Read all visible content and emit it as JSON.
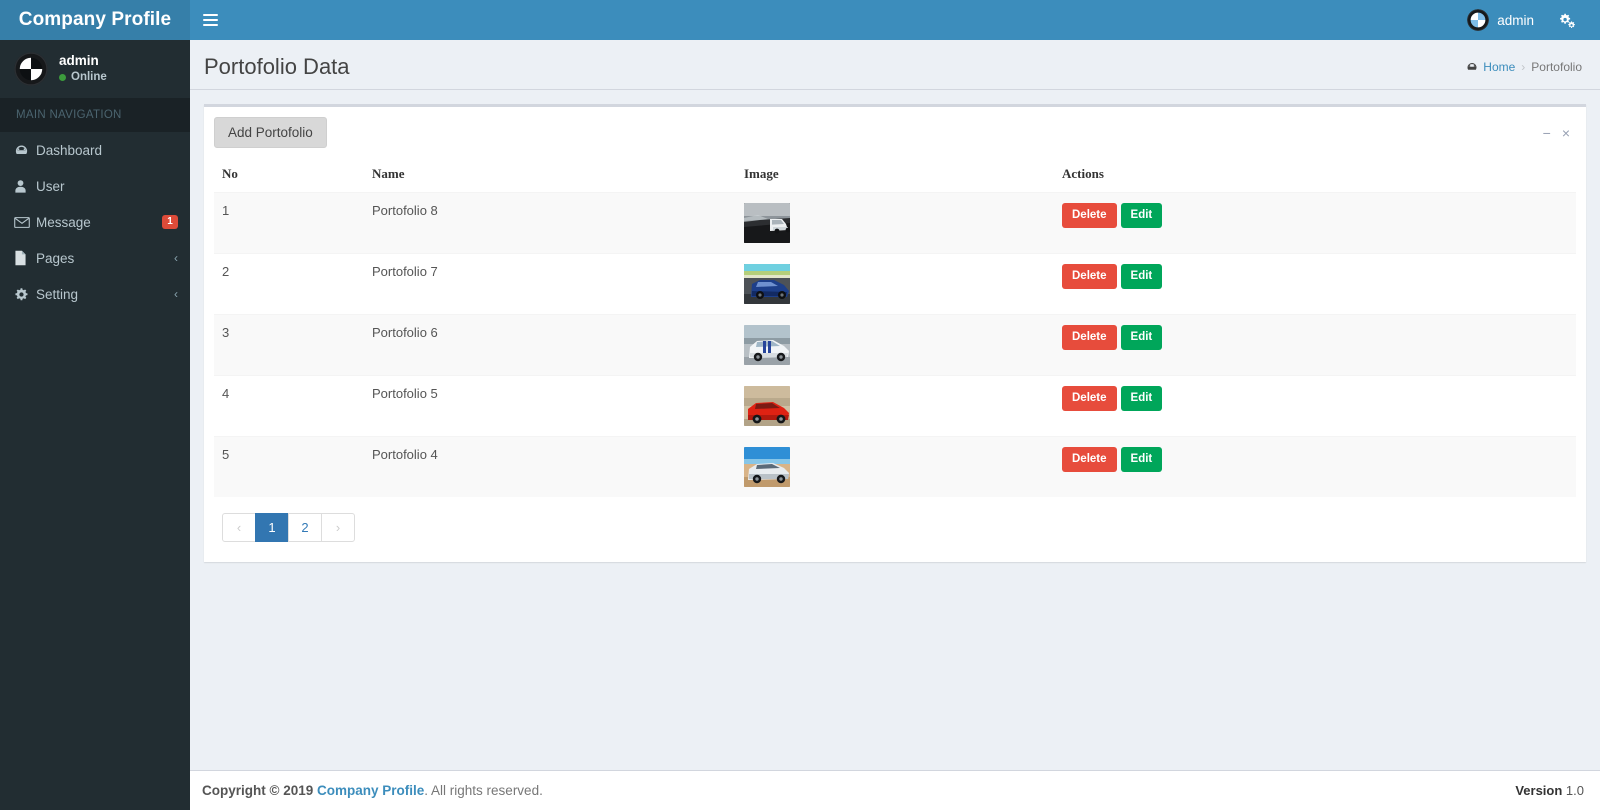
{
  "header": {
    "brand": "Company Profile",
    "toggle_icon": "hamburger-icon",
    "user_name": "admin",
    "settings_icon": "gears-icon",
    "avatar_icon": "bmw-logo-avatar"
  },
  "sidebar": {
    "user": {
      "name": "admin",
      "status": "Online"
    },
    "nav_header": "MAIN NAVIGATION",
    "items": [
      {
        "label": "Dashboard",
        "icon": "dashboard-icon",
        "badge": "",
        "chevron": ""
      },
      {
        "label": "User",
        "icon": "user-icon",
        "badge": "",
        "chevron": ""
      },
      {
        "label": "Message",
        "icon": "envelope-icon",
        "badge": "1",
        "chevron": ""
      },
      {
        "label": "Pages",
        "icon": "file-icon",
        "badge": "",
        "chevron": "‹"
      },
      {
        "label": "Setting",
        "icon": "gear-icon",
        "badge": "",
        "chevron": "‹"
      }
    ]
  },
  "page": {
    "title": "Portofolio Data",
    "breadcrumb": {
      "home": "Home",
      "home_icon": "dashboard-icon",
      "separator": "›",
      "current": "Portofolio"
    }
  },
  "box": {
    "add_button": "Add Portofolio",
    "minimize_icon": "−",
    "close_icon": "×",
    "columns": [
      "No",
      "Name",
      "Image",
      "Actions"
    ],
    "rows": [
      {
        "no": "1",
        "name": "Portofolio 8",
        "image": "white-car-on-road-thumbnail",
        "delete": "Delete",
        "edit": "Edit"
      },
      {
        "no": "2",
        "name": "Portofolio 7",
        "image": "blue-car-on-track-thumbnail",
        "delete": "Delete",
        "edit": "Edit"
      },
      {
        "no": "3",
        "name": "Portofolio 6",
        "image": "white-blue-striped-mustang-thumbnail",
        "delete": "Delete",
        "edit": "Edit"
      },
      {
        "no": "4",
        "name": "Portofolio 5",
        "image": "red-sports-car-thumbnail",
        "delete": "Delete",
        "edit": "Edit"
      },
      {
        "no": "5",
        "name": "Portofolio 4",
        "image": "silver-car-in-desert-thumbnail",
        "delete": "Delete",
        "edit": "Edit"
      }
    ],
    "pagination": {
      "prev": "‹",
      "pages": [
        "1",
        "2"
      ],
      "next": "›",
      "active": "1"
    }
  },
  "footer": {
    "copyright_label": "Copyright © 2019",
    "brand_link": "Company Profile",
    "rights": ". All rights reserved.",
    "version_label": "Version",
    "version_number": "1.0"
  },
  "colors": {
    "navbar": "#3c8dbc",
    "logo": "#367fa9",
    "sidebar": "#222d32",
    "sidebar_header": "#1a2226",
    "content_bg": "#ecf0f5",
    "delete_button": "#e74c3c",
    "edit_button": "#00a65a",
    "badge": "#dd4b39",
    "pagination_active": "#3276b1",
    "link": "#3c8dbc",
    "online_dot": "#3c9b3c"
  }
}
